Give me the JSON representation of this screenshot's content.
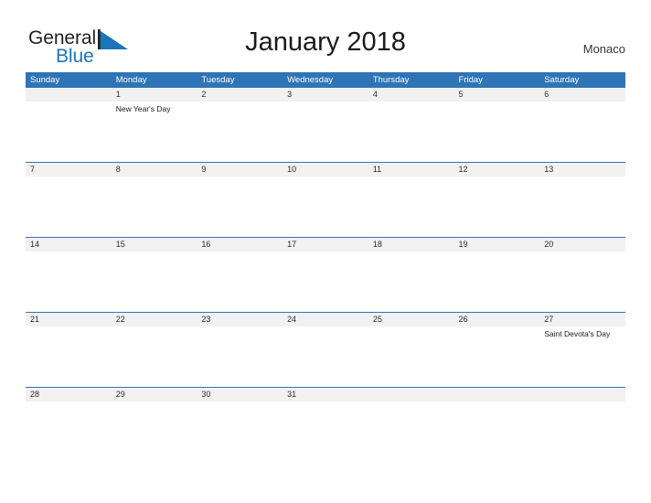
{
  "brand": {
    "name_part1": "General",
    "name_part2": "Blue",
    "flag_icon": "blue-flag-triangle",
    "color_dark": "#231f20",
    "color_blue": "#1b75bb"
  },
  "header": {
    "title": "January 2018",
    "region": "Monaco"
  },
  "theme": {
    "header_blue": "#2f74b5",
    "date_band_gray": "#f1f1f1",
    "text_dark": "#1a1a1a",
    "page_background": "#ffffff"
  },
  "calendar": {
    "month": "January",
    "year": "2018",
    "weekdays": [
      "Sunday",
      "Monday",
      "Tuesday",
      "Wednesday",
      "Thursday",
      "Friday",
      "Saturday"
    ],
    "weeks": [
      {
        "days": [
          {
            "date": "",
            "event": ""
          },
          {
            "date": "1",
            "event": "New Year's Day"
          },
          {
            "date": "2",
            "event": ""
          },
          {
            "date": "3",
            "event": ""
          },
          {
            "date": "4",
            "event": ""
          },
          {
            "date": "5",
            "event": ""
          },
          {
            "date": "6",
            "event": ""
          }
        ]
      },
      {
        "days": [
          {
            "date": "7",
            "event": ""
          },
          {
            "date": "8",
            "event": ""
          },
          {
            "date": "9",
            "event": ""
          },
          {
            "date": "10",
            "event": ""
          },
          {
            "date": "11",
            "event": ""
          },
          {
            "date": "12",
            "event": ""
          },
          {
            "date": "13",
            "event": ""
          }
        ]
      },
      {
        "days": [
          {
            "date": "14",
            "event": ""
          },
          {
            "date": "15",
            "event": ""
          },
          {
            "date": "16",
            "event": ""
          },
          {
            "date": "17",
            "event": ""
          },
          {
            "date": "18",
            "event": ""
          },
          {
            "date": "19",
            "event": ""
          },
          {
            "date": "20",
            "event": ""
          }
        ]
      },
      {
        "days": [
          {
            "date": "21",
            "event": ""
          },
          {
            "date": "22",
            "event": ""
          },
          {
            "date": "23",
            "event": ""
          },
          {
            "date": "24",
            "event": ""
          },
          {
            "date": "25",
            "event": ""
          },
          {
            "date": "26",
            "event": ""
          },
          {
            "date": "27",
            "event": "Saint Devota's Day"
          }
        ]
      },
      {
        "days": [
          {
            "date": "28",
            "event": ""
          },
          {
            "date": "29",
            "event": ""
          },
          {
            "date": "30",
            "event": ""
          },
          {
            "date": "31",
            "event": ""
          },
          {
            "date": "",
            "event": ""
          },
          {
            "date": "",
            "event": ""
          },
          {
            "date": "",
            "event": ""
          }
        ]
      }
    ]
  }
}
